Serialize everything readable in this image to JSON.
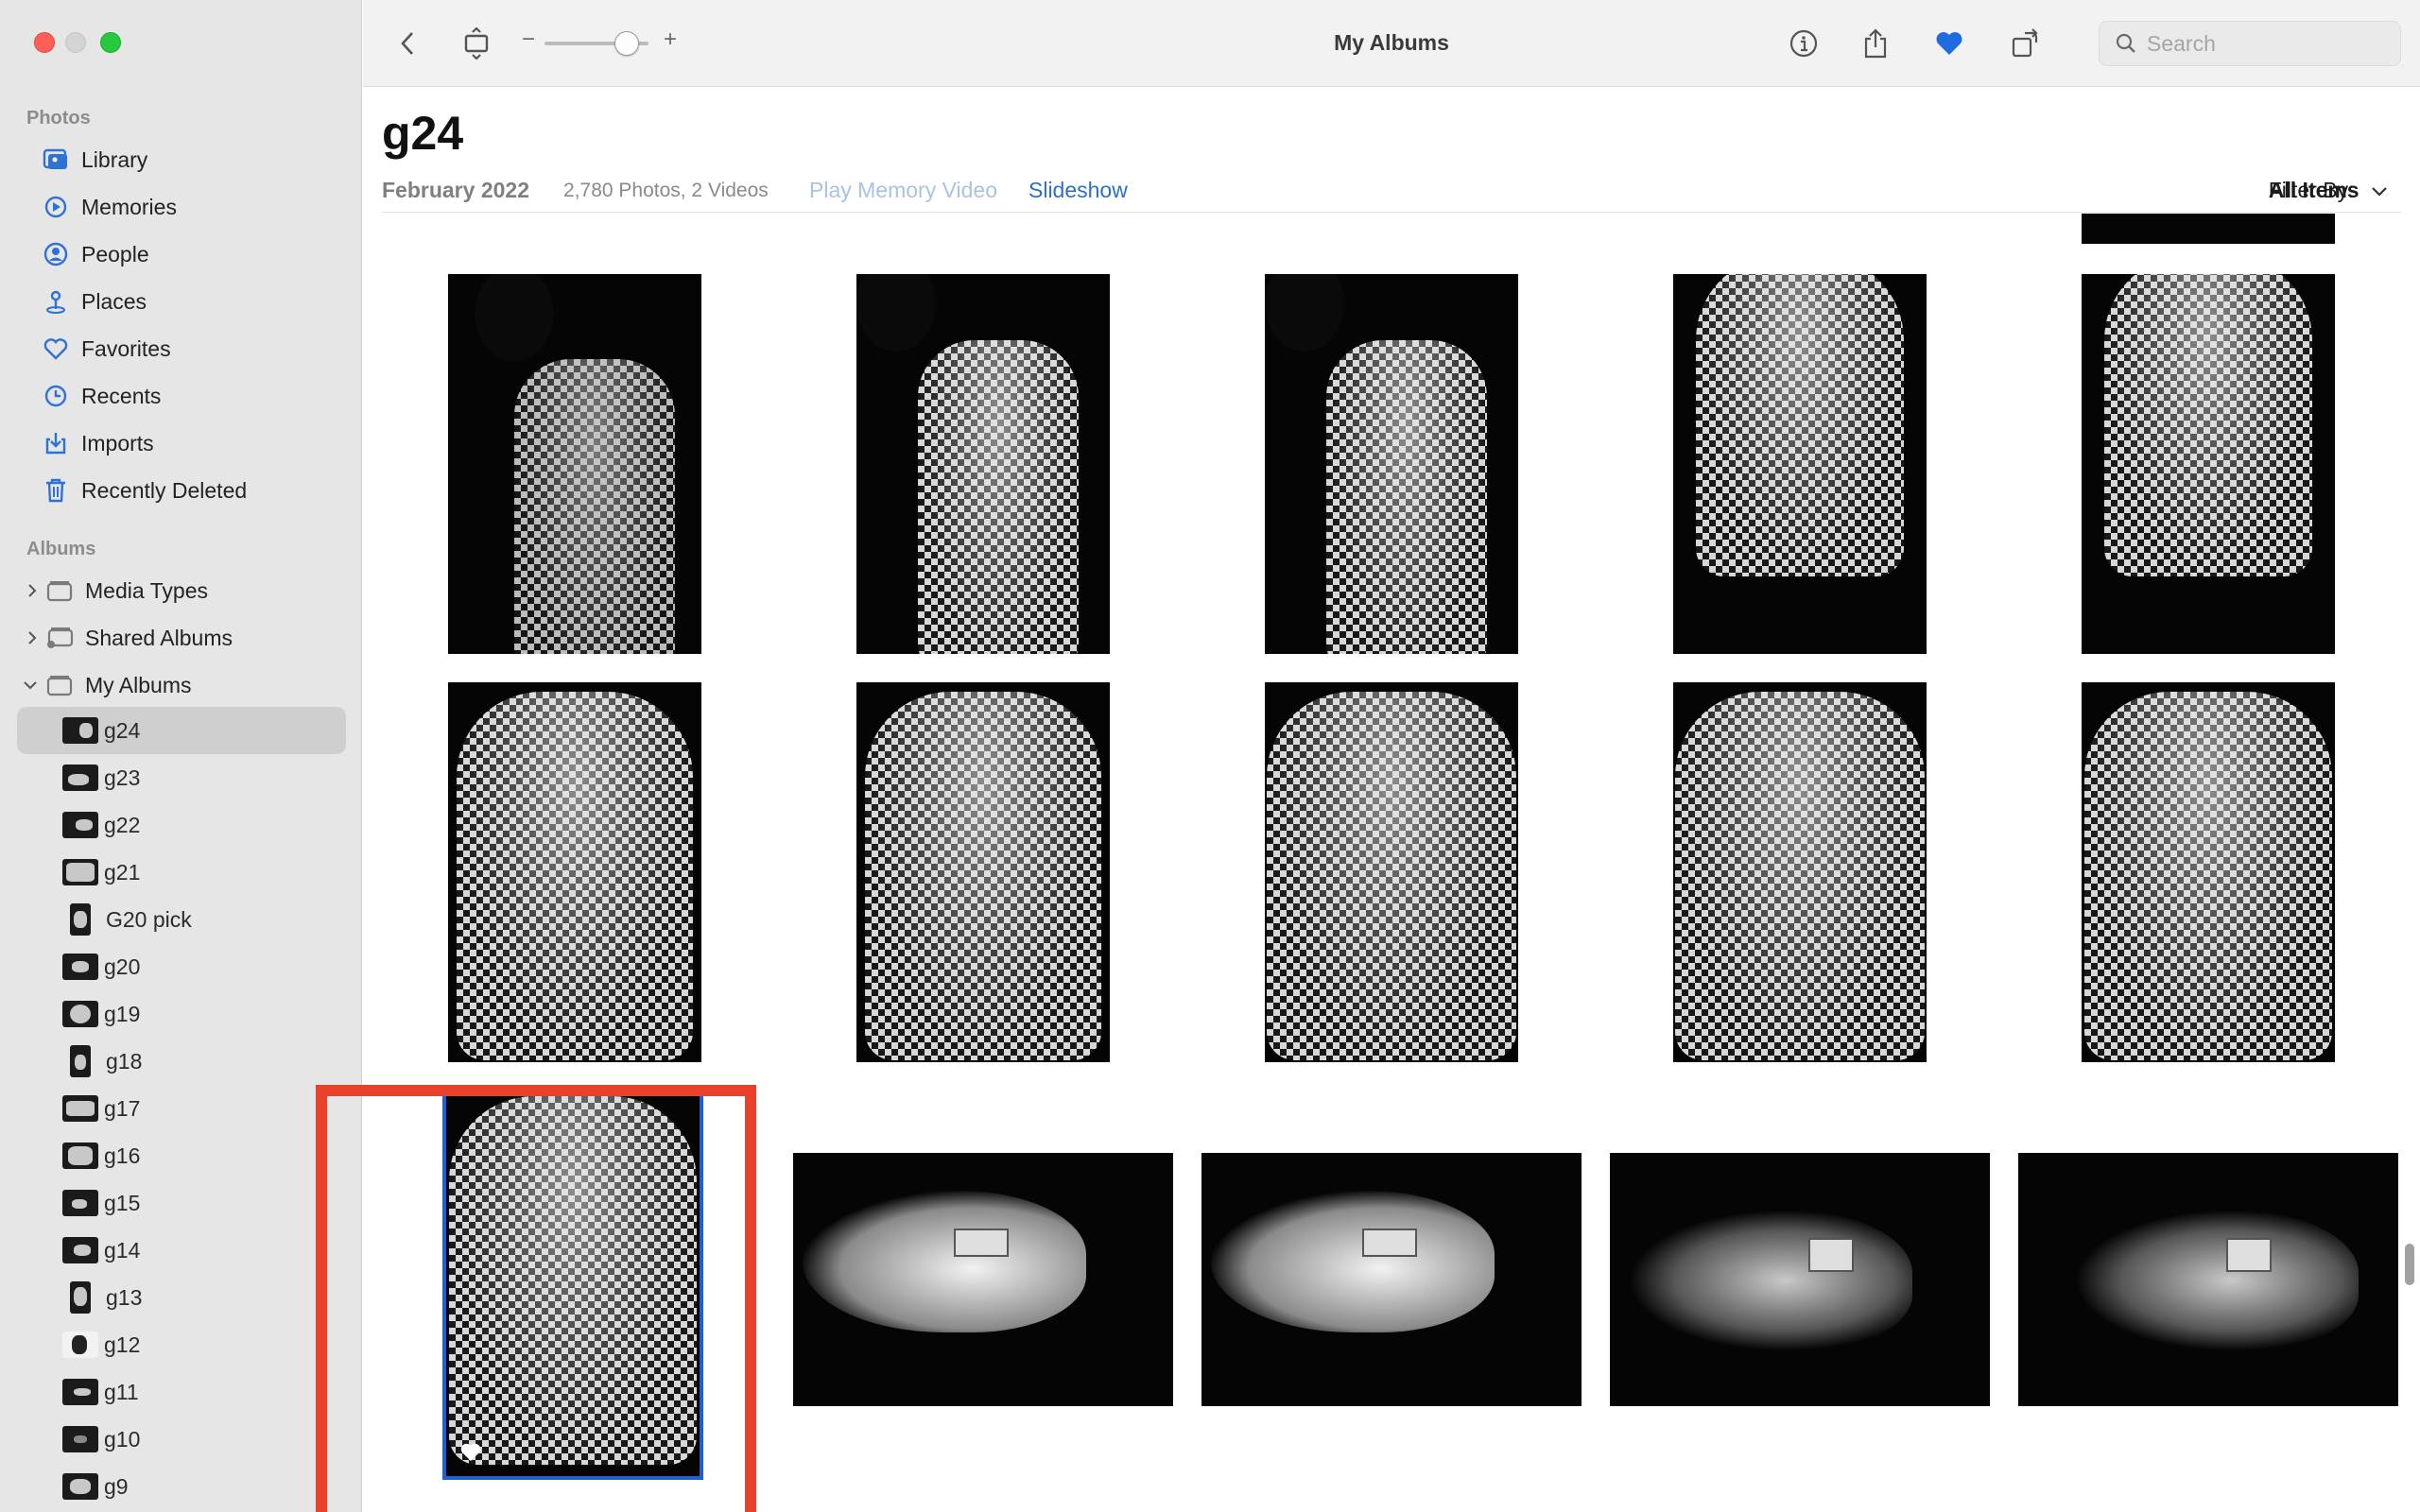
{
  "window": {
    "title": "My Albums"
  },
  "sidebar": {
    "photos_header": "Photos",
    "photos_items": [
      {
        "label": "Library",
        "icon": "library-icon"
      },
      {
        "label": "Memories",
        "icon": "memories-icon"
      },
      {
        "label": "People",
        "icon": "people-icon"
      },
      {
        "label": "Places",
        "icon": "places-icon"
      },
      {
        "label": "Favorites",
        "icon": "heart-icon"
      },
      {
        "label": "Recents",
        "icon": "clock-icon"
      },
      {
        "label": "Imports",
        "icon": "import-icon"
      },
      {
        "label": "Recently Deleted",
        "icon": "trash-icon"
      }
    ],
    "albums_header": "Albums",
    "album_groups": [
      {
        "label": "Media Types",
        "expanded": false
      },
      {
        "label": "Shared Albums",
        "expanded": false
      },
      {
        "label": "My Albums",
        "expanded": true
      }
    ],
    "my_albums": [
      {
        "label": "g24",
        "selected": true
      },
      {
        "label": "g23"
      },
      {
        "label": "g22"
      },
      {
        "label": "g21"
      },
      {
        "label": "G20 pick"
      },
      {
        "label": "g20"
      },
      {
        "label": "g19"
      },
      {
        "label": "g18"
      },
      {
        "label": "g17"
      },
      {
        "label": "g16"
      },
      {
        "label": "g15"
      },
      {
        "label": "g14"
      },
      {
        "label": "g13"
      },
      {
        "label": "g12"
      },
      {
        "label": "g11"
      },
      {
        "label": "g10"
      },
      {
        "label": "g9"
      }
    ]
  },
  "toolbar": {
    "zoom_minus": "−",
    "zoom_plus": "+",
    "zoom_level": 0.72,
    "search_placeholder": "Search"
  },
  "album": {
    "title": "g24",
    "date": "February 2022",
    "count": "2,780 Photos, 2 Videos",
    "play_memory": "Play Memory Video",
    "slideshow": "Slideshow",
    "filter_label": "Filter By:",
    "filter_value": "All Items"
  },
  "colors": {
    "accent": "#2c6fc9",
    "favorite_heart": "#1e6ce0",
    "selection": "#1e5fd1",
    "annotation_frame": "#e8412c",
    "close": "#fe5f57",
    "zoom": "#28c840"
  }
}
